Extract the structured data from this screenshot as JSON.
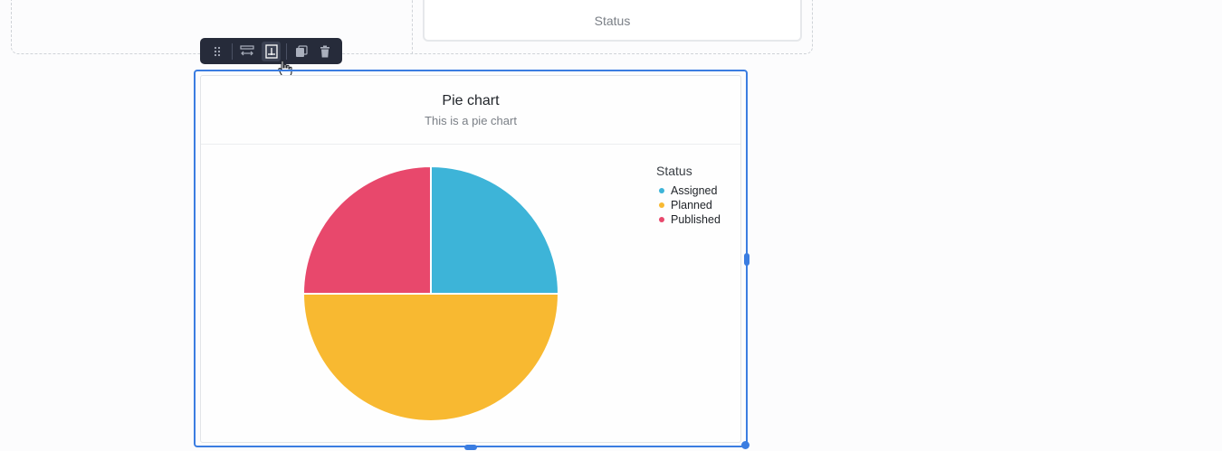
{
  "status_card": {
    "label": "Status"
  },
  "toolbar": {
    "buttons": [
      {
        "icon": "drag-handle-icon"
      },
      {
        "icon": "fit-width-icon"
      },
      {
        "icon": "fit-height-icon",
        "active": true
      },
      {
        "icon": "duplicate-icon"
      },
      {
        "icon": "trash-icon"
      }
    ]
  },
  "chart_card": {
    "title": "Pie chart",
    "subtitle": "This is a pie chart"
  },
  "chart_data": {
    "type": "pie",
    "title": "Pie chart",
    "subtitle": "This is a pie chart",
    "legend_title": "Status",
    "legend_position": "top-right",
    "slices": [
      {
        "label": "Assigned",
        "value": 25,
        "color": "#3db4d8"
      },
      {
        "label": "Planned",
        "value": 50,
        "color": "#f8b931"
      },
      {
        "label": "Published",
        "value": 25,
        "color": "#e8486c"
      }
    ]
  },
  "colors": {
    "selection": "#3b7de1",
    "toolbar_bg": "#262b3a"
  }
}
